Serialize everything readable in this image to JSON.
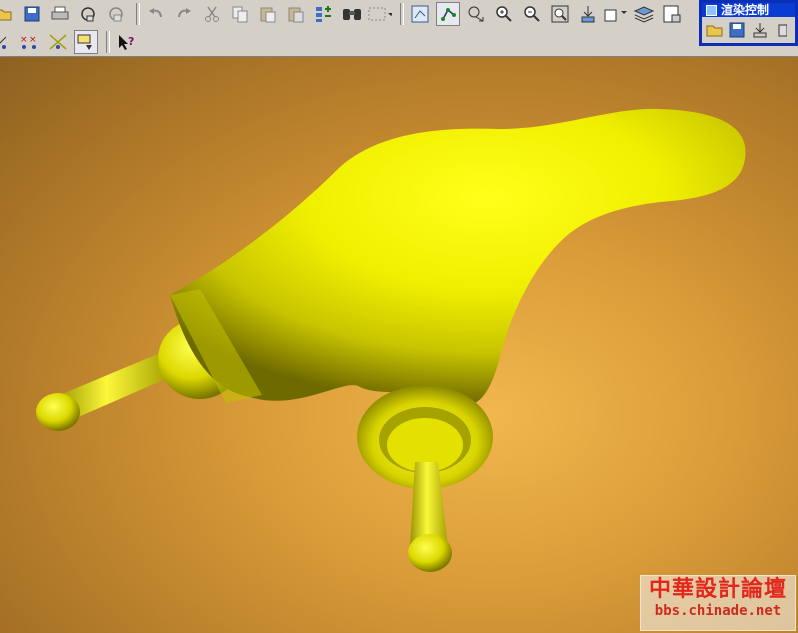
{
  "render_panel": {
    "title": "渲染控制"
  },
  "watermark": {
    "name": "中華設計論壇",
    "url": "bbs.chinade.net"
  },
  "colors": {
    "toolbar": "#d4d0c8",
    "panel_border": "#0a2fb6",
    "model": "#f2f000",
    "background": "#e0a540"
  },
  "toolbar": {
    "row1": [
      "open-icon",
      "save-icon",
      "print-icon",
      "cut-view-icon",
      "copy-view-icon",
      "undo-icon",
      "redo-icon",
      "cut-icon",
      "copy-icon",
      "paste-icon",
      "paste-special-icon",
      "regenerate-icon",
      "find-icon",
      "select-box-icon",
      "saved-view-icon",
      "datum-display-icon",
      "spin-center-icon",
      "zoom-in-icon",
      "zoom-out-icon",
      "refit-icon",
      "reorient-icon",
      "view-list-icon",
      "layers-icon",
      "model-tree-icon"
    ],
    "row2": [
      "datum-plane-icon",
      "datum-axis-icon",
      "datum-point-icon",
      "coord-sys-icon",
      "whats-this-icon"
    ],
    "render": [
      "open-scene-icon",
      "save-scene-icon",
      "export-icon",
      "more-icon"
    ]
  }
}
